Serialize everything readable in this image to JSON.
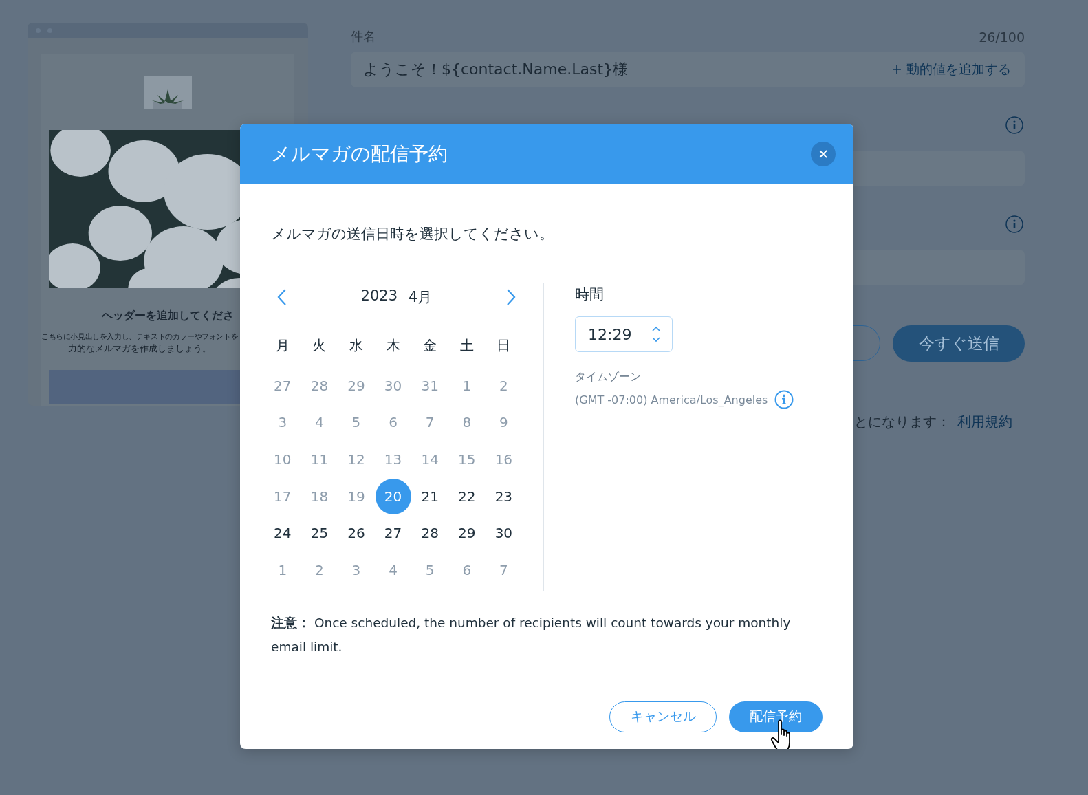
{
  "preview": {
    "heading": "ヘッダーを追加してくださ",
    "body_lines": [
      "こちらに小見出しを入力し、テキストのカラーやフォントを",
      "力的なメルマガを作成しましょう。"
    ]
  },
  "subject": {
    "label": "件名",
    "counter": "26/100",
    "value": "ようこそ！${contact.Name.Last}様",
    "add_dynamic": "+ 動的値を追加する"
  },
  "send_now_button": "今すぐ送信",
  "terms": {
    "text": "とになります：",
    "link": "利用規約"
  },
  "dialog": {
    "title": "メルマガの配信予約",
    "prompt": "メルマガの送信日時を選択してください。",
    "calendar": {
      "year": "2023",
      "month": "4月",
      "weekdays": [
        "月",
        "火",
        "水",
        "木",
        "金",
        "土",
        "日"
      ],
      "days": [
        {
          "label": "27",
          "disabled": true,
          "selected": false
        },
        {
          "label": "28",
          "disabled": true,
          "selected": false
        },
        {
          "label": "29",
          "disabled": true,
          "selected": false
        },
        {
          "label": "30",
          "disabled": true,
          "selected": false
        },
        {
          "label": "31",
          "disabled": true,
          "selected": false
        },
        {
          "label": "1",
          "disabled": true,
          "selected": false
        },
        {
          "label": "2",
          "disabled": true,
          "selected": false
        },
        {
          "label": "3",
          "disabled": true,
          "selected": false
        },
        {
          "label": "4",
          "disabled": true,
          "selected": false
        },
        {
          "label": "5",
          "disabled": true,
          "selected": false
        },
        {
          "label": "6",
          "disabled": true,
          "selected": false
        },
        {
          "label": "7",
          "disabled": true,
          "selected": false
        },
        {
          "label": "8",
          "disabled": true,
          "selected": false
        },
        {
          "label": "9",
          "disabled": true,
          "selected": false
        },
        {
          "label": "10",
          "disabled": true,
          "selected": false
        },
        {
          "label": "11",
          "disabled": true,
          "selected": false
        },
        {
          "label": "12",
          "disabled": true,
          "selected": false
        },
        {
          "label": "13",
          "disabled": true,
          "selected": false
        },
        {
          "label": "14",
          "disabled": true,
          "selected": false
        },
        {
          "label": "15",
          "disabled": true,
          "selected": false
        },
        {
          "label": "16",
          "disabled": true,
          "selected": false
        },
        {
          "label": "17",
          "disabled": true,
          "selected": false
        },
        {
          "label": "18",
          "disabled": true,
          "selected": false
        },
        {
          "label": "19",
          "disabled": true,
          "selected": false
        },
        {
          "label": "20",
          "disabled": false,
          "selected": true
        },
        {
          "label": "21",
          "disabled": false,
          "selected": false
        },
        {
          "label": "22",
          "disabled": false,
          "selected": false
        },
        {
          "label": "23",
          "disabled": false,
          "selected": false
        },
        {
          "label": "24",
          "disabled": false,
          "selected": false
        },
        {
          "label": "25",
          "disabled": false,
          "selected": false
        },
        {
          "label": "26",
          "disabled": false,
          "selected": false
        },
        {
          "label": "27",
          "disabled": false,
          "selected": false
        },
        {
          "label": "28",
          "disabled": false,
          "selected": false
        },
        {
          "label": "29",
          "disabled": false,
          "selected": false
        },
        {
          "label": "30",
          "disabled": false,
          "selected": false
        },
        {
          "label": "1",
          "disabled": true,
          "selected": false
        },
        {
          "label": "2",
          "disabled": true,
          "selected": false
        },
        {
          "label": "3",
          "disabled": true,
          "selected": false
        },
        {
          "label": "4",
          "disabled": true,
          "selected": false
        },
        {
          "label": "5",
          "disabled": true,
          "selected": false
        },
        {
          "label": "6",
          "disabled": true,
          "selected": false
        },
        {
          "label": "7",
          "disabled": true,
          "selected": false
        }
      ]
    },
    "time": {
      "label": "時間",
      "value": "12:29"
    },
    "timezone": {
      "label": "タイムゾーン",
      "value": "(GMT -07:00) America/Los_Angeles"
    },
    "note": "**注意：** Once scheduled, the number of recipients will count towards your monthly email limit.",
    "buttons": {
      "cancel": "キャンセル",
      "schedule": "配信予約"
    }
  }
}
